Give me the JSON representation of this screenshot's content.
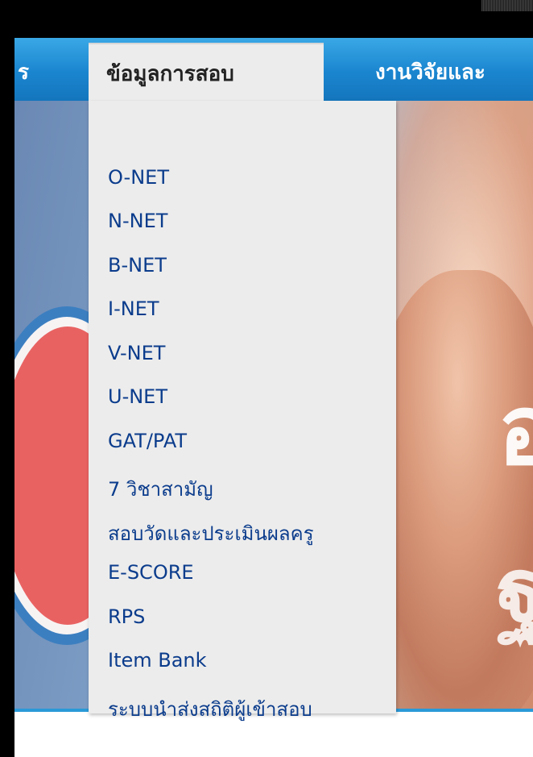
{
  "nav": {
    "left_partial": "ร",
    "active": "ข้อมูลการสอบ",
    "right_partial": "งานวิจัยและ"
  },
  "hero": {
    "glyph_top": "อ",
    "glyph_bottom": "ฐ"
  },
  "dropdown": {
    "items": [
      "O-NET",
      "N-NET",
      "B-NET",
      "I-NET",
      "V-NET",
      "U-NET",
      "GAT/PAT",
      "7 วิชาสามัญ",
      "สอบวัดและประเมินผลครู",
      "E-SCORE",
      "RPS",
      "Item Bank",
      "ระบบนำส่งสถิติผู้เข้าสอบ"
    ]
  },
  "colors": {
    "nav_bar": "#1a85cf",
    "menu_bg": "#ececec",
    "menu_link": "#0b3c8c",
    "active_text": "#222222"
  }
}
